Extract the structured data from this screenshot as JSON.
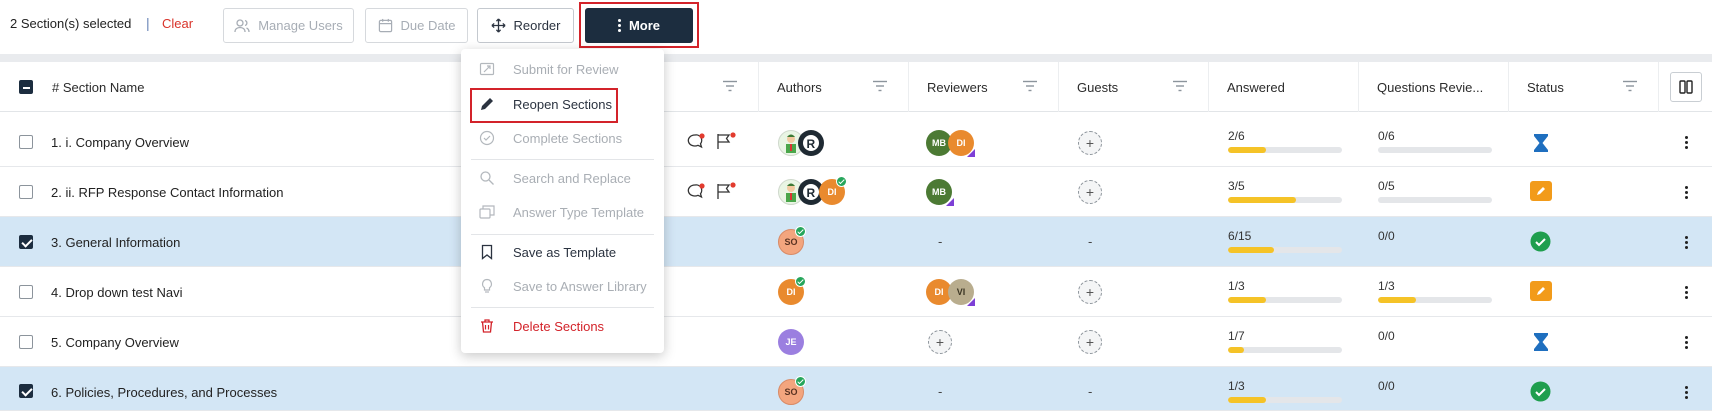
{
  "toolbar": {
    "selection_text": "2 Section(s) selected",
    "separator": "|",
    "clear_label": "Clear",
    "manage_users_label": "Manage Users",
    "due_date_label": "Due Date",
    "reorder_label": "Reorder",
    "more_label": "More"
  },
  "columns": {
    "section_name": "# Section Name",
    "authors": "Authors",
    "reviewers": "Reviewers",
    "guests": "Guests",
    "answered": "Answered",
    "questions_reviewed": "Questions Revie...",
    "status": "Status"
  },
  "menu": {
    "items": [
      {
        "label": "Submit for Review",
        "icon": "submit-icon",
        "enabled": false
      },
      {
        "label": "Reopen Sections",
        "icon": "pencil-icon",
        "enabled": true
      },
      {
        "label": "Complete Sections",
        "icon": "check-circle-icon",
        "enabled": false
      },
      {
        "label": "Search and Replace",
        "icon": "search-icon",
        "enabled": false
      },
      {
        "label": "Answer Type Template",
        "icon": "template-icon",
        "enabled": false
      },
      {
        "label": "Save as Template",
        "icon": "bookmark-icon",
        "enabled": true
      },
      {
        "label": "Save to Answer Library",
        "icon": "lightbulb-icon",
        "enabled": false
      },
      {
        "label": "Delete Sections",
        "icon": "trash-icon",
        "enabled": true
      }
    ]
  },
  "rows": [
    {
      "number": "1.",
      "name": "i. Company Overview",
      "checked": false,
      "answered": "2/6",
      "answered_fraction": 0.33,
      "reviewed": "0/6",
      "reviewed_fraction": 0,
      "reviewers": [
        "MB",
        "DI"
      ],
      "authors": [
        "person",
        "R"
      ],
      "guest": "add",
      "status": "hourglass",
      "has_comment_flags": true
    },
    {
      "number": "2.",
      "name": "ii. RFP Response Contact Information",
      "checked": false,
      "answered": "3/5",
      "answered_fraction": 0.6,
      "reviewed": "0/5",
      "reviewed_fraction": 0,
      "reviewers": [
        "MB"
      ],
      "authors": [
        "person",
        "R",
        "DI"
      ],
      "guest": "add",
      "status": "edit",
      "has_comment_flags": true
    },
    {
      "number": "3.",
      "name": "General Information",
      "checked": true,
      "answered": "6/15",
      "answered_fraction": 0.4,
      "reviewed": "0/0",
      "reviewed_fraction": 0,
      "reviewers": [
        "-"
      ],
      "authors": [
        "SO"
      ],
      "guest": "-",
      "status": "complete",
      "has_comment_flags": false
    },
    {
      "number": "4.",
      "name": "Drop down test Navi",
      "checked": false,
      "answered": "1/3",
      "answered_fraction": 0.33,
      "reviewed": "1/3",
      "reviewed_fraction": 0.33,
      "reviewers": [
        "DI",
        "VI"
      ],
      "authors": [
        "DI"
      ],
      "guest": "add",
      "status": "edit",
      "has_comment_flags": false
    },
    {
      "number": "5.",
      "name": "Company Overview",
      "checked": false,
      "answered": "1/7",
      "answered_fraction": 0.14,
      "reviewed": "0/0",
      "reviewed_fraction": 0,
      "reviewers": [
        "add"
      ],
      "authors": [
        "JE"
      ],
      "guest": "add",
      "status": "hourglass",
      "has_comment_flags": false
    },
    {
      "number": "6.",
      "name": "Policies, Procedures, and Processes",
      "checked": true,
      "answered": "1/3",
      "answered_fraction": 0.33,
      "reviewed": "0/0",
      "reviewed_fraction": 0,
      "reviewers": [
        "-"
      ],
      "authors": [
        "SO"
      ],
      "guest": "-",
      "status": "complete",
      "has_comment_flags": false
    }
  ],
  "colors": {
    "primary_dark": "#1c2d3f",
    "highlight_red": "#d3232a",
    "selected_row": "#d3e6f5",
    "progress": "#f5c327",
    "status_blue": "#1f6fbf",
    "status_orange": "#f29b1a",
    "status_green": "#1f9e4e"
  }
}
